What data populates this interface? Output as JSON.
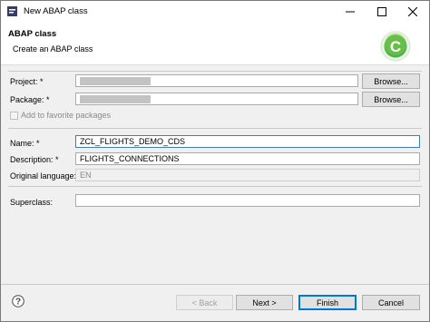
{
  "window": {
    "title": "New ABAP class"
  },
  "header": {
    "title": "ABAP class",
    "subtitle": "Create an ABAP class",
    "logo_icon": "abap-class-logo"
  },
  "form": {
    "project": {
      "label": "Project: *",
      "value": "",
      "redacted": true,
      "browse": "Browse..."
    },
    "package": {
      "label": "Package: *",
      "value": "",
      "redacted": true,
      "browse": "Browse..."
    },
    "favorites": {
      "label": "Add to favorite packages",
      "checked": false,
      "enabled": false
    },
    "name": {
      "label": "Name: *",
      "value": "ZCL_FLIGHTS_DEMO_CDS"
    },
    "description": {
      "label": "Description: *",
      "value": "FLIGHTS_CONNECTIONS"
    },
    "language": {
      "label": "Original language:",
      "value": "EN"
    },
    "superclass": {
      "label": "Superclass:",
      "value": ""
    }
  },
  "footer": {
    "back": "< Back",
    "next": "Next >",
    "finish": "Finish",
    "cancel": "Cancel",
    "help_icon": "question-mark-icon"
  },
  "colors": {
    "accent": "#0078d7",
    "logo": "#4caf50"
  }
}
